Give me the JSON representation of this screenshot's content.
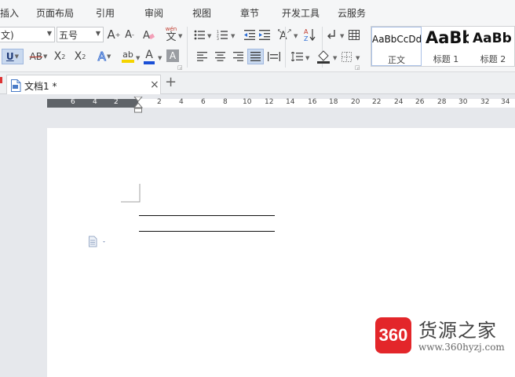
{
  "menu": [
    "插入",
    "页面布局",
    "引用",
    "审阅",
    "视图",
    "章节",
    "开发工具",
    "云服务"
  ],
  "ribbon": {
    "font_name": "文)",
    "font_size": "五号",
    "grow_font": "A",
    "shrink_font": "A",
    "pinyin_top": "wén",
    "pinyin_bottom": "文",
    "underline": "U",
    "strikethrough": "AB",
    "superscript": "X",
    "superscript_mark": "2",
    "subscript": "X",
    "subscript_mark": "2",
    "text_effect": "A",
    "highlight": "ab",
    "font_color": "A",
    "char_shading": "A",
    "highlight_color": "#f5d400",
    "font_color_bar": "#1a4fd6",
    "styles": [
      {
        "sample": "AaBbCcDd",
        "name": "正文"
      },
      {
        "sample": "AaBb",
        "name": "标题 1"
      },
      {
        "sample": "AaBb",
        "name": "标题 2"
      }
    ]
  },
  "tab": {
    "title": "文档1 *",
    "close": "×",
    "add": "+"
  },
  "ruler": {
    "left_numbers": [
      "6",
      "4",
      "2"
    ],
    "right_numbers": [
      "2",
      "4",
      "6",
      "8",
      "10",
      "12",
      "14",
      "16",
      "18",
      "20",
      "22",
      "24",
      "26",
      "28",
      "30",
      "32",
      "34"
    ]
  },
  "watermark": {
    "badge": "360",
    "title": "货源之家",
    "url": "www.360hyzj.com"
  }
}
